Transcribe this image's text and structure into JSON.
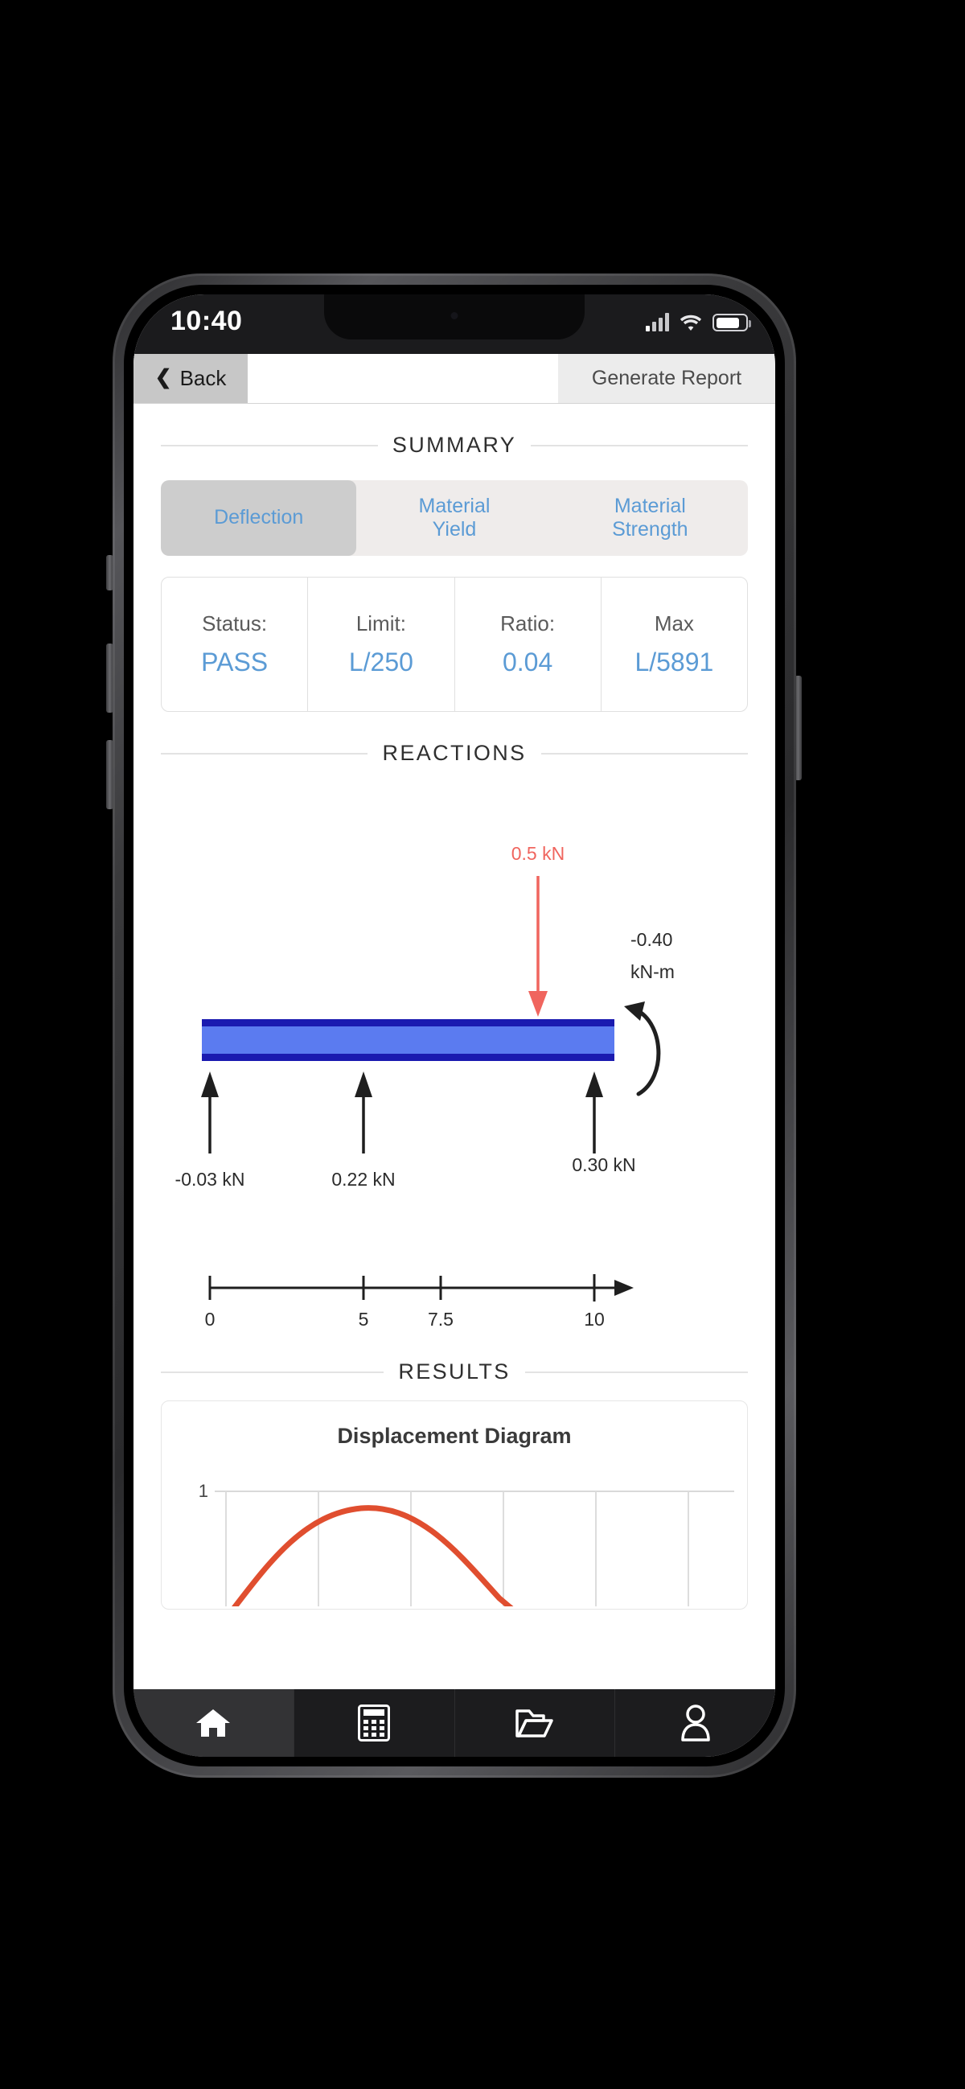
{
  "status_bar": {
    "time": "10:40",
    "signal_icon": "cellular-signal-icon",
    "wifi_icon": "wifi-icon",
    "battery_icon": "battery-icon"
  },
  "nav_bar": {
    "back_label": "Back",
    "back_chevron": "chevron-left-icon",
    "report_label": "Generate Report"
  },
  "summary": {
    "heading": "SUMMARY",
    "tabs": [
      {
        "label": "Deflection",
        "active": true
      },
      {
        "label": "Material\nYield",
        "line1": "Material",
        "line2": "Yield",
        "active": false
      },
      {
        "label": "Material\nStrength",
        "line1": "Material",
        "line2": "Strength",
        "active": false
      }
    ],
    "stats": [
      {
        "key": "Status:",
        "value": "PASS"
      },
      {
        "key": "Limit:",
        "value": "L/250"
      },
      {
        "key": "Ratio:",
        "value": "0.04"
      },
      {
        "key": "Max",
        "value": "L/5891"
      }
    ]
  },
  "reactions": {
    "heading": "REACTIONS",
    "load_label": "0.5 kN",
    "moment_label_line1": "-0.40",
    "moment_label_line2": "kN-m",
    "reaction_labels": [
      "-0.03 kN",
      "0.22 kN",
      "0.30 kN"
    ],
    "axis_ticks": [
      "0",
      "5",
      "7.5",
      "10"
    ],
    "beam_color": "#5b7bf0",
    "beam_edge_color": "#1a1ab0",
    "load_color": "#f0655e"
  },
  "results": {
    "heading": "RESULTS",
    "chart_title": "Displacement Diagram",
    "y_axis_label": "1"
  },
  "chart_data": {
    "type": "line",
    "title": "Displacement Diagram",
    "xlabel": "",
    "ylabel": "",
    "ylim": [
      0,
      1
    ],
    "xlim": [
      0,
      10
    ],
    "yticks": [
      1
    ],
    "grid": true,
    "series": [
      {
        "name": "Displacement",
        "color": "#e04e2f",
        "x": [
          0,
          1,
          2,
          3,
          4,
          5,
          6,
          7,
          8,
          9,
          10
        ],
        "y": [
          0.0,
          0.45,
          0.78,
          0.93,
          0.98,
          0.92,
          0.74,
          0.48,
          0.2,
          0.02,
          0.0
        ]
      }
    ]
  },
  "reactions_chart": {
    "type": "diagram",
    "beam_span": [
      0,
      10
    ],
    "point_load": {
      "position": 7.5,
      "magnitude": 0.5,
      "unit": "kN",
      "direction": "down"
    },
    "moment": {
      "position": 10,
      "magnitude": -0.4,
      "unit": "kN-m"
    },
    "supports": [
      {
        "position": 0,
        "reaction": -0.03,
        "unit": "kN"
      },
      {
        "position": 5,
        "reaction": 0.22,
        "unit": "kN"
      },
      {
        "position": 10,
        "reaction": 0.3,
        "unit": "kN"
      }
    ],
    "axis_ticks": [
      0,
      5,
      7.5,
      10
    ]
  },
  "tab_bar": {
    "items": [
      {
        "icon": "home-icon",
        "active": true
      },
      {
        "icon": "calculator-icon",
        "active": false
      },
      {
        "icon": "folder-open-icon",
        "active": false
      },
      {
        "icon": "user-icon",
        "active": false
      }
    ]
  }
}
